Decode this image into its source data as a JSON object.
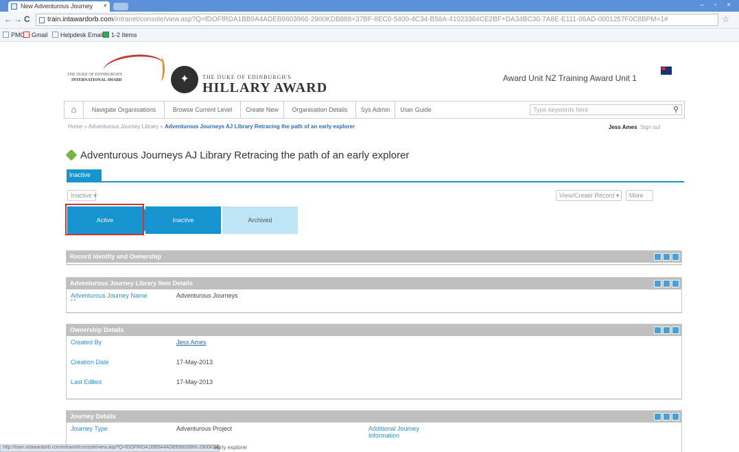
{
  "browser": {
    "tab_title": "New Adventurous Journey",
    "tab_close": "×",
    "url_host": "train.intawardorb.com",
    "url_rest": "/intranet/console/view.asp?Q=fDOFfRDA1BB9A4ADEB9603966-2900KDB888=37BF-8EC0-5400-4C34-B58A-41023384CE2BF+DA34BC30-7A8E-E111-06AD-0001257F0C8BPM=1#",
    "bookmarks": [
      "PMC",
      "Gmail",
      "Helpdesk Email",
      "1-2 Items"
    ],
    "window_controls": "– ▫ ×",
    "status_text": "http://train.intawardorb.com/intranet/console/view.asp?Q=fDOFfRDA1BB9A4ADEB9603966-2900KDB888",
    "status_tail": "early explorer"
  },
  "header": {
    "logo_line1": "THE DUKE OF EDINBURGH'S",
    "logo_line2": "INTERNATIONAL AWARD",
    "hillary_sub": "THE DUKE OF EDINBURGH'S",
    "hillary_main": "HILLARY AWARD",
    "award_unit": "Award Unit NZ Training Award Unit 1"
  },
  "nav": {
    "items": [
      "Navigate Organisations",
      "Browse Current Level",
      "Create New",
      "Organisation Details",
      "Sys Admin",
      "User Guide"
    ],
    "search_placeholder": "Type keywords here"
  },
  "breadcrumb": {
    "path": "Home » Adventurous Journey Library » ",
    "current": "Adventurous Journeys AJ Library Retracing the path of an early explorer"
  },
  "user": {
    "name": "Jess Ames",
    "signout": "Sign out"
  },
  "page": {
    "title": "Adventurous Journeys AJ Library Retracing the path of an early explorer",
    "tab": "Inactive",
    "status_select": "Inactive ▾",
    "view_create": "View/Create Record ▾",
    "more": "More"
  },
  "status_steps": [
    "Active",
    "Inactive",
    "Archived"
  ],
  "panels": {
    "record_identity": "Record Identity and Ownership",
    "library_details": {
      "header": "Adventurous Journey Library Item Details",
      "label": "Adventurous Journey Name",
      "required": "* *",
      "value": "Adventurous Journeys"
    },
    "ownership": {
      "header": "Ownership Details",
      "rows": [
        {
          "label": "Created By",
          "value": "Jess Ames"
        },
        {
          "label": "Creation Date",
          "value": "17-May-2013"
        },
        {
          "label": "Last Edited",
          "value": "17-May-2013"
        }
      ]
    },
    "journey": {
      "header": "Journey Details",
      "type_label": "Journey Type",
      "type_value": "Adventurous Project",
      "additional_label_1": "Additional Journey",
      "additional_label_2": "Information"
    }
  },
  "colors": {
    "accent": "#1694d0",
    "highlight": "#d9302b",
    "panel_header": "#bfbfbf"
  }
}
